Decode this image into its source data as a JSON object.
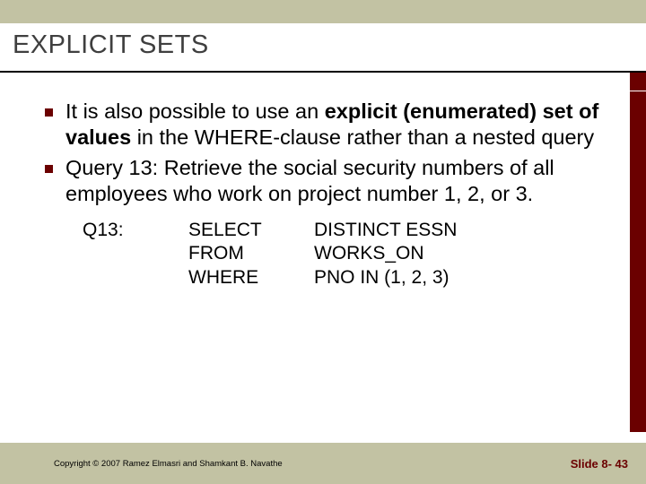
{
  "title": "EXPLICIT SETS",
  "bullets": [
    {
      "segments": [
        {
          "text": "It is also possible to use an ",
          "bold": false
        },
        {
          "text": "explicit (enumerated) set of values",
          "bold": true
        },
        {
          "text": " in the WHERE-clause rather than a nested query",
          "bold": false
        }
      ]
    },
    {
      "segments": [
        {
          "text": "Query 13: Retrieve the social security numbers of all employees who work on project number 1, 2, or 3.",
          "bold": false
        }
      ]
    }
  ],
  "query": {
    "label": "Q13:",
    "lines": [
      {
        "keyword": "SELECT",
        "arg": "DISTINCT ESSN"
      },
      {
        "keyword": "FROM",
        "arg": "WORKS_ON"
      },
      {
        "keyword": "WHERE",
        "arg": "PNO IN  (1, 2, 3)"
      }
    ]
  },
  "footer": {
    "copyright": "Copyright © 2007 Ramez Elmasri and Shamkant B. Navathe",
    "slide": "Slide 8- 43"
  }
}
